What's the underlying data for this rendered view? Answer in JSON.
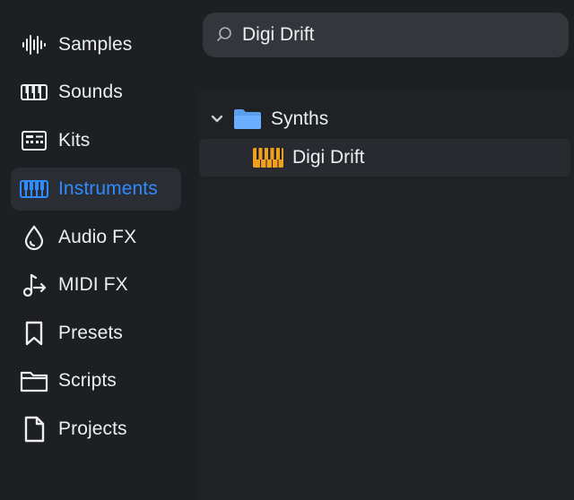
{
  "sidebar": {
    "items": [
      {
        "label": "Samples",
        "icon": "waveform-icon",
        "active": false
      },
      {
        "label": "Sounds",
        "icon": "keyboard-icon",
        "active": false
      },
      {
        "label": "Kits",
        "icon": "drum-machine-icon",
        "active": false
      },
      {
        "label": "Instruments",
        "icon": "piano-icon",
        "active": true
      },
      {
        "label": "Audio FX",
        "icon": "droplet-icon",
        "active": false
      },
      {
        "label": "MIDI FX",
        "icon": "midi-note-arrow-icon",
        "active": false
      },
      {
        "label": "Presets",
        "icon": "bookmark-icon",
        "active": false
      },
      {
        "label": "Scripts",
        "icon": "folder-icon",
        "active": false
      },
      {
        "label": "Projects",
        "icon": "document-icon",
        "active": false
      }
    ]
  },
  "search": {
    "value": "Digi Drift",
    "placeholder": ""
  },
  "tree": {
    "folder_label": "Synths",
    "folder_expanded": true,
    "child_label": "Digi Drift"
  },
  "colors": {
    "accent": "#2f8cff",
    "instrument_orange": "#f0a020",
    "folder_blue": "#6aaeff",
    "background": "#1e1f23",
    "panel": "#202125",
    "search_bg": "#34363c"
  }
}
